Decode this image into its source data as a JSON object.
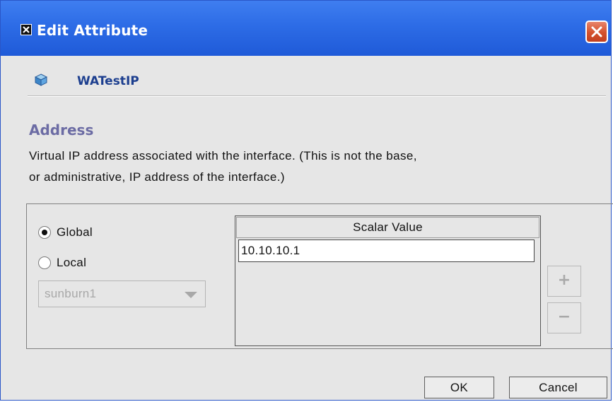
{
  "window": {
    "title": "Edit Attribute",
    "close_icon": "close-x"
  },
  "entity": {
    "icon": "cube-icon",
    "name": "WATestIP"
  },
  "attribute": {
    "name": "Address",
    "description_line1": "Virtual IP address associated with the interface. (This is not the base,",
    "description_line2": "or administrative, IP address of the interface.)"
  },
  "scope": {
    "global_label": "Global",
    "local_label": "Local",
    "selected": "Global",
    "node_select_value": "sunburn1"
  },
  "table": {
    "header": "Scalar Value",
    "rows": [
      "10.10.10.1"
    ]
  },
  "buttons": {
    "add_label": "+",
    "remove_label": "−",
    "ok_label": "OK",
    "cancel_label": "Cancel"
  },
  "colors": {
    "titlebar": "#2d6ce6",
    "entity_name": "#1d3f8f",
    "section_title": "#6c6ca4",
    "close_button": "#d4512c"
  }
}
